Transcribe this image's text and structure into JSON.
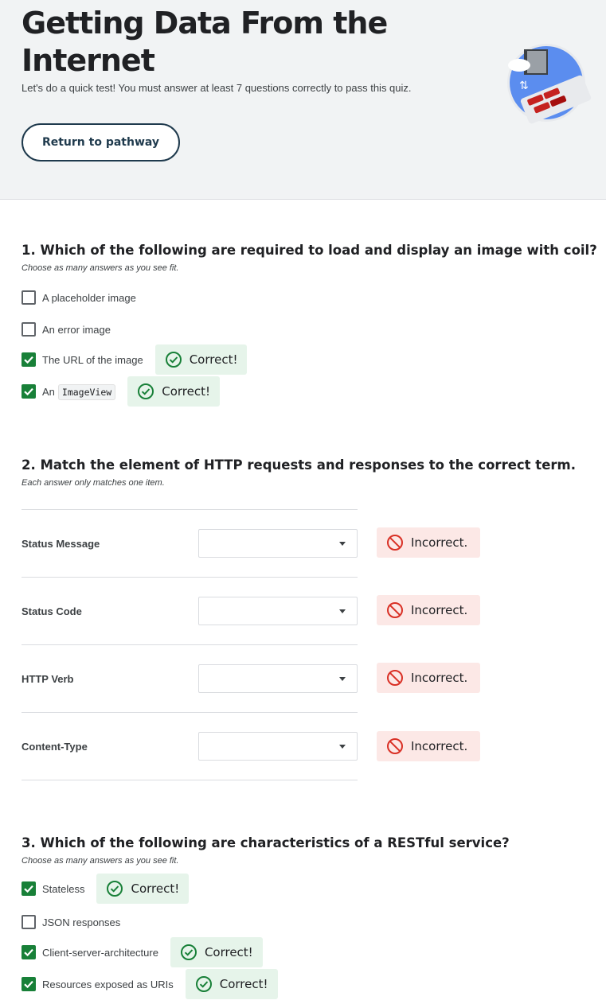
{
  "header": {
    "title": "Getting Data From the Internet",
    "subtitle": "Let's do a quick test! You must answer at least 7 questions correctly to pass this quiz.",
    "return_button": "Return to pathway"
  },
  "colors": {
    "correct_bg": "#e6f4ea",
    "correct_icon": "#188038",
    "incorrect_bg": "#fce8e6",
    "incorrect_icon": "#d93025",
    "checkbox_checked": "#188038"
  },
  "q1": {
    "title": "1. Which of the following are required to load and display an image with coil?",
    "hint": "Choose as many answers as you see fit.",
    "options": [
      {
        "label": "A placeholder image",
        "checked": false
      },
      {
        "label": "An error image",
        "checked": false
      },
      {
        "label": "The URL of the image",
        "checked": true,
        "feedback": "Correct!"
      },
      {
        "label": "An",
        "code": "ImageView",
        "checked": true,
        "feedback": "Correct!"
      }
    ]
  },
  "q2": {
    "title": "2. Match the element of HTTP requests and responses to the correct term.",
    "hint": "Each answer only matches one item.",
    "rows": [
      {
        "label": "Status Message",
        "selected": "",
        "feedback": "Incorrect."
      },
      {
        "label": "Status Code",
        "selected": "",
        "feedback": "Incorrect."
      },
      {
        "label": "HTTP Verb",
        "selected": "",
        "feedback": "Incorrect."
      },
      {
        "label": "Content-Type",
        "selected": "",
        "feedback": "Incorrect."
      }
    ]
  },
  "q3": {
    "title": "3. Which of the following are characteristics of a RESTful service?",
    "hint": "Choose as many answers as you see fit.",
    "options": [
      {
        "label": "Stateless",
        "checked": true,
        "feedback": "Correct!"
      },
      {
        "label": "JSON responses",
        "checked": false
      },
      {
        "label": "Client-server-architecture",
        "checked": true,
        "feedback": "Correct!"
      },
      {
        "label": "Resources exposed as URIs",
        "checked": true,
        "feedback": "Correct!"
      }
    ]
  }
}
